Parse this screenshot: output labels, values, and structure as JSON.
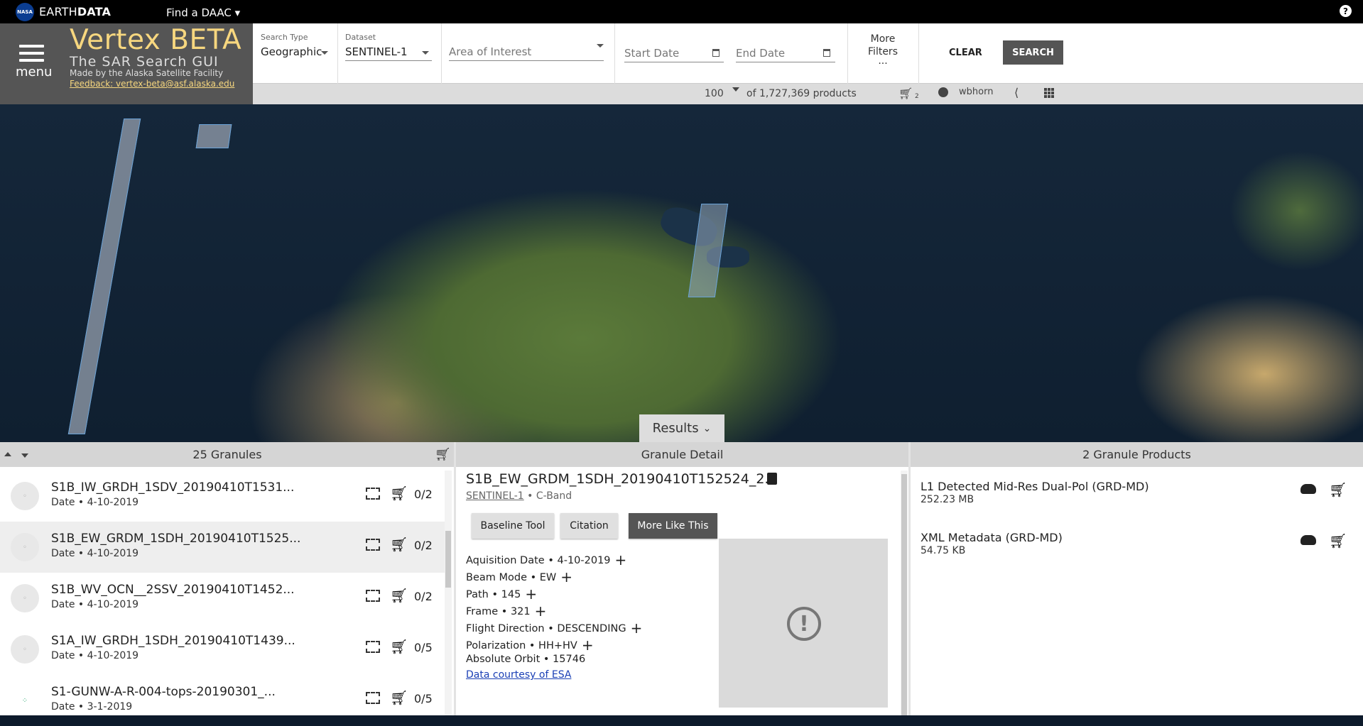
{
  "topbar": {
    "nasa_logo": "NASA",
    "earthdata_a": "EARTH",
    "earthdata_b": "DATA",
    "find_daac": "Find a DAAC ▾",
    "help": "?"
  },
  "header": {
    "menu_label": "menu",
    "title": "Vertex BETA",
    "subtitle": "The SAR Search GUI",
    "made_by": "Made by the Alaska Satellite Facility",
    "feedback": "Feedback: vertex-beta@asf.alaska.edu"
  },
  "filters": {
    "search_type_label": "Search Type",
    "search_type_value": "Geographic",
    "dataset_label": "Dataset",
    "dataset_value": "SENTINEL-1",
    "aoi_placeholder": "Area of Interest",
    "start_date_placeholder": "Start Date",
    "end_date_placeholder": "End Date",
    "more_filters_line1": "More",
    "more_filters_line2": "Filters",
    "more_filters_dots": "...",
    "clear_label": "CLEAR",
    "search_label": "SEARCH"
  },
  "toolbar": {
    "max_results": "100",
    "total": "of 1,727,369 products",
    "cart_count": "2",
    "username": "wbhorn"
  },
  "map": {
    "results_tab": "Results"
  },
  "granules_panel": {
    "header": "25 Granules",
    "items": [
      {
        "name": "S1B_IW_GRDH_1SDV_20190410T1531...",
        "date": "Date • 4-10-2019",
        "count": "0/2"
      },
      {
        "name": "S1B_EW_GRDM_1SDH_20190410T1525...",
        "date": "Date • 4-10-2019",
        "count": "0/2"
      },
      {
        "name": "S1B_WV_OCN__2SSV_20190410T1452...",
        "date": "Date • 4-10-2019",
        "count": "0/2"
      },
      {
        "name": "S1A_IW_GRDH_1SDH_20190410T1439...",
        "date": "Date • 4-10-2019",
        "count": "0/5"
      },
      {
        "name": "S1-GUNW-A-R-004-tops-20190301_...",
        "date": "Date • 3-1-2019",
        "count": "0/5"
      }
    ]
  },
  "detail_panel": {
    "header": "Granule Detail",
    "title": "S1B_EW_GRDM_1SDH_20190410T152524_2...",
    "dataset_link": "SENTINEL-1",
    "band": " • C-Band",
    "buttons": {
      "baseline": "Baseline Tool",
      "citation": "Citation",
      "more_like": "More Like This"
    },
    "meta": [
      "Aquisition Date • 4-10-2019",
      "Beam Mode • EW",
      "Path • 145",
      "Frame • 321",
      "Flight Direction • DESCENDING",
      "Polarization • HH+HV",
      "Absolute Orbit • 15746"
    ],
    "esa_link": "Data courtesy of ESA",
    "browse_warning": "!"
  },
  "products_panel": {
    "header": "2 Granule Products",
    "items": [
      {
        "name": "L1 Detected Mid-Res Dual-Pol (GRD-MD)",
        "size": "252.23 MB"
      },
      {
        "name": "XML Metadata (GRD-MD)",
        "size": "54.75 KB"
      }
    ]
  },
  "colors": {
    "accent_gold": "#f7d77f",
    "header_gray": "#555555",
    "link_blue": "#1a3fb5",
    "swath_border": "#6aa3d8"
  }
}
